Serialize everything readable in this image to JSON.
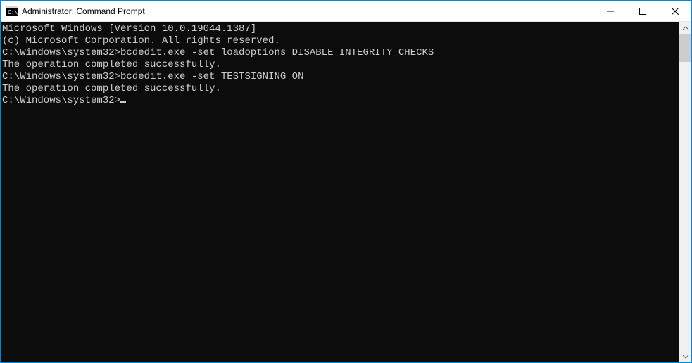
{
  "window": {
    "title": "Administrator: Command Prompt"
  },
  "console": {
    "header1": "Microsoft Windows [Version 10.0.19044.1387]",
    "header2": "(c) Microsoft Corporation. All rights reserved.",
    "blank1": "",
    "prompt1_path": "C:\\Windows\\system32>",
    "prompt1_cmd": "bcdedit.exe -set loadoptions DISABLE_INTEGRITY_CHECKS",
    "result1": "The operation completed successfully.",
    "blank2": "",
    "prompt2_path": "C:\\Windows\\system32>",
    "prompt2_cmd": "bcdedit.exe -set TESTSIGNING ON",
    "result2": "The operation completed successfully.",
    "blank3": "",
    "prompt3_path": "C:\\Windows\\system32>"
  }
}
